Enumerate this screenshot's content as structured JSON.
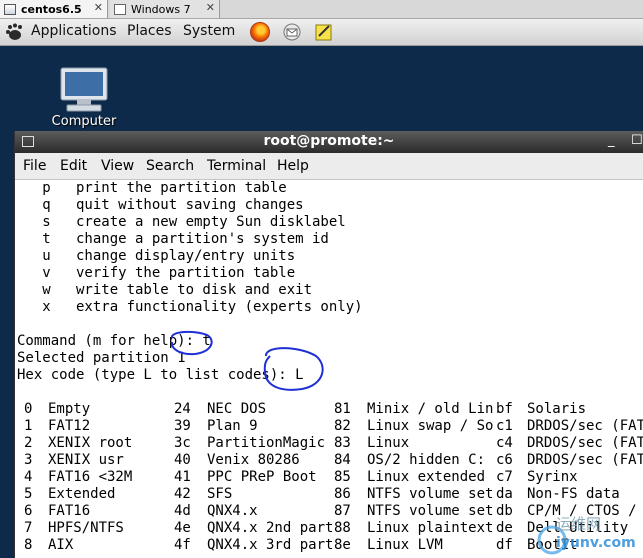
{
  "vm_tabs": [
    {
      "label": "centos6.5",
      "active": true
    },
    {
      "label": "Windows 7",
      "active": false
    }
  ],
  "panel": {
    "menus": [
      "Applications",
      "Places",
      "System"
    ],
    "launchers": [
      "firefox-icon",
      "mail-icon",
      "notes-icon"
    ]
  },
  "desktop": {
    "icon_label": "Computer"
  },
  "terminal": {
    "title": "root@promote:~",
    "menu": [
      "File",
      "Edit",
      "View",
      "Search",
      "Terminal",
      "Help"
    ],
    "help_lines": [
      "   p   print the partition table",
      "   q   quit without saving changes",
      "   s   create a new empty Sun disklabel",
      "   t   change a partition's system id",
      "   u   change display/entry units",
      "   v   verify the partition table",
      "   w   write table to disk and exit",
      "   x   extra functionality (experts only)"
    ],
    "prompt_lines": [
      "Command (m for help): t",
      "Selected partition 1",
      "Hex code (type L to list codes): L"
    ],
    "partition_types": [
      [
        [
          "0",
          "Empty"
        ],
        [
          "24",
          "NEC DOS"
        ],
        [
          "81",
          "Minix / old Lin"
        ],
        [
          "bf",
          "Solaris"
        ]
      ],
      [
        [
          "1",
          "FAT12"
        ],
        [
          "39",
          "Plan 9"
        ],
        [
          "82",
          "Linux swap / So"
        ],
        [
          "c1",
          "DRDOS/sec (FAT-"
        ]
      ],
      [
        [
          "2",
          "XENIX root"
        ],
        [
          "3c",
          "PartitionMagic"
        ],
        [
          "83",
          "Linux"
        ],
        [
          "c4",
          "DRDOS/sec (FAT-"
        ]
      ],
      [
        [
          "3",
          "XENIX usr"
        ],
        [
          "40",
          "Venix 80286"
        ],
        [
          "84",
          "OS/2 hidden C:"
        ],
        [
          "c6",
          "DRDOS/sec (FAT-"
        ]
      ],
      [
        [
          "4",
          "FAT16 <32M"
        ],
        [
          "41",
          "PPC PReP Boot"
        ],
        [
          "85",
          "Linux extended"
        ],
        [
          "c7",
          "Syrinx"
        ]
      ],
      [
        [
          "5",
          "Extended"
        ],
        [
          "42",
          "SFS"
        ],
        [
          "86",
          "NTFS volume set"
        ],
        [
          "da",
          "Non-FS data"
        ]
      ],
      [
        [
          "6",
          "FAT16"
        ],
        [
          "4d",
          "QNX4.x"
        ],
        [
          "87",
          "NTFS volume set"
        ],
        [
          "db",
          "CP/M / CTOS /"
        ]
      ],
      [
        [
          "7",
          "HPFS/NTFS"
        ],
        [
          "4e",
          "QNX4.x 2nd part"
        ],
        [
          "88",
          "Linux plaintext"
        ],
        [
          "de",
          "Dell Utility"
        ]
      ],
      [
        [
          "8",
          "AIX"
        ],
        [
          "4f",
          "QNX4.x 3rd part"
        ],
        [
          "8e",
          "Linux LVM"
        ],
        [
          "df",
          "BootIt"
        ]
      ]
    ]
  },
  "watermark": {
    "top": "运维网",
    "bottom": "iyunv.com"
  },
  "colors": {
    "desktop": "#0e2a4a",
    "annotation": "#1f2fd6"
  }
}
